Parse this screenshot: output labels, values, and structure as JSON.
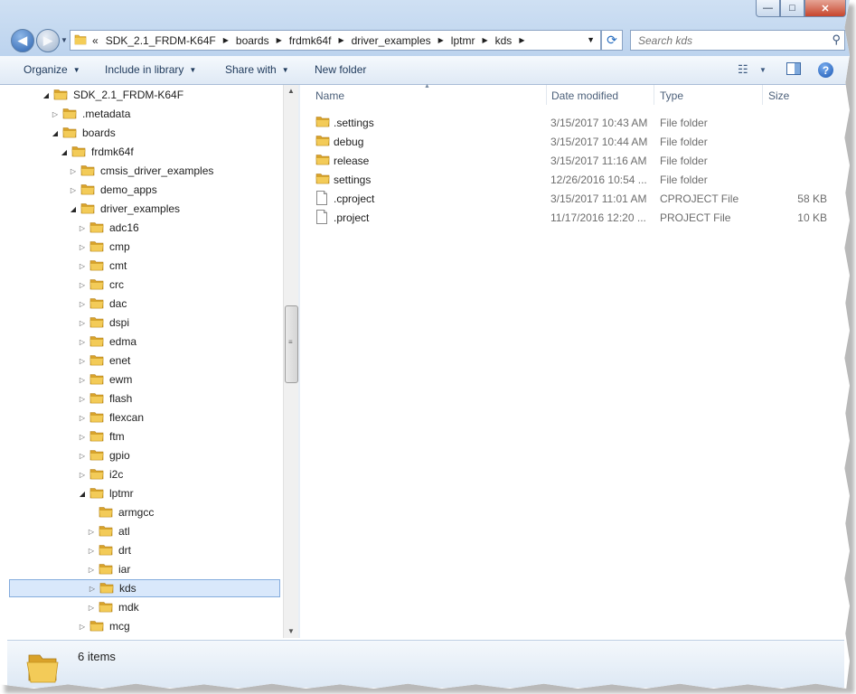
{
  "window": {
    "caption_buttons": [
      "—",
      "□",
      "✕"
    ]
  },
  "address_bar": {
    "overflow": "«",
    "breadcrumbs": [
      "SDK_2.1_FRDM-K64F",
      "boards",
      "frdmk64f",
      "driver_examples",
      "lptmr",
      "kds"
    ]
  },
  "search": {
    "placeholder": "Search kds"
  },
  "toolbar": {
    "organize": "Organize",
    "include_in_library": "Include in library",
    "share_with": "Share with",
    "new_folder": "New folder"
  },
  "nav_tree": [
    {
      "label": "SDK_2.1_FRDM-K64F",
      "depth": 0,
      "state": "open"
    },
    {
      "label": ".metadata",
      "depth": 1,
      "state": "closed"
    },
    {
      "label": "boards",
      "depth": 1,
      "state": "open"
    },
    {
      "label": "frdmk64f",
      "depth": 2,
      "state": "open"
    },
    {
      "label": "cmsis_driver_examples",
      "depth": 3,
      "state": "closed"
    },
    {
      "label": "demo_apps",
      "depth": 3,
      "state": "closed"
    },
    {
      "label": "driver_examples",
      "depth": 3,
      "state": "open"
    },
    {
      "label": "adc16",
      "depth": 4,
      "state": "closed"
    },
    {
      "label": "cmp",
      "depth": 4,
      "state": "closed"
    },
    {
      "label": "cmt",
      "depth": 4,
      "state": "closed"
    },
    {
      "label": "crc",
      "depth": 4,
      "state": "closed"
    },
    {
      "label": "dac",
      "depth": 4,
      "state": "closed"
    },
    {
      "label": "dspi",
      "depth": 4,
      "state": "closed"
    },
    {
      "label": "edma",
      "depth": 4,
      "state": "closed"
    },
    {
      "label": "enet",
      "depth": 4,
      "state": "closed"
    },
    {
      "label": "ewm",
      "depth": 4,
      "state": "closed"
    },
    {
      "label": "flash",
      "depth": 4,
      "state": "closed"
    },
    {
      "label": "flexcan",
      "depth": 4,
      "state": "closed"
    },
    {
      "label": "ftm",
      "depth": 4,
      "state": "closed"
    },
    {
      "label": "gpio",
      "depth": 4,
      "state": "closed"
    },
    {
      "label": "i2c",
      "depth": 4,
      "state": "closed"
    },
    {
      "label": "lptmr",
      "depth": 4,
      "state": "open"
    },
    {
      "label": "armgcc",
      "depth": 5,
      "state": "none"
    },
    {
      "label": "atl",
      "depth": 5,
      "state": "closed"
    },
    {
      "label": "drt",
      "depth": 5,
      "state": "closed"
    },
    {
      "label": "iar",
      "depth": 5,
      "state": "closed"
    },
    {
      "label": "kds",
      "depth": 5,
      "state": "closed",
      "selected": true
    },
    {
      "label": "mdk",
      "depth": 5,
      "state": "closed"
    },
    {
      "label": "mcg",
      "depth": 4,
      "state": "closed"
    }
  ],
  "columns": {
    "name": "Name",
    "date_modified": "Date modified",
    "type": "Type",
    "size": "Size"
  },
  "files": [
    {
      "name": ".settings",
      "date": "3/15/2017 10:43 AM",
      "type": "File folder",
      "size": "",
      "kind": "folder"
    },
    {
      "name": "debug",
      "date": "3/15/2017 10:44 AM",
      "type": "File folder",
      "size": "",
      "kind": "folder"
    },
    {
      "name": "release",
      "date": "3/15/2017 11:16 AM",
      "type": "File folder",
      "size": "",
      "kind": "folder"
    },
    {
      "name": "settings",
      "date": "12/26/2016 10:54 ...",
      "type": "File folder",
      "size": "",
      "kind": "folder"
    },
    {
      "name": ".cproject",
      "date": "3/15/2017 11:01 AM",
      "type": "CPROJECT File",
      "size": "58 KB",
      "kind": "file"
    },
    {
      "name": ".project",
      "date": "11/17/2016 12:20 ...",
      "type": "PROJECT File",
      "size": "10 KB",
      "kind": "file"
    }
  ],
  "details": {
    "item_count": "6 items"
  },
  "colors": {
    "folder": "#e8b73a",
    "selection": "#d9e8fb",
    "chrome": "#c6daf1"
  }
}
